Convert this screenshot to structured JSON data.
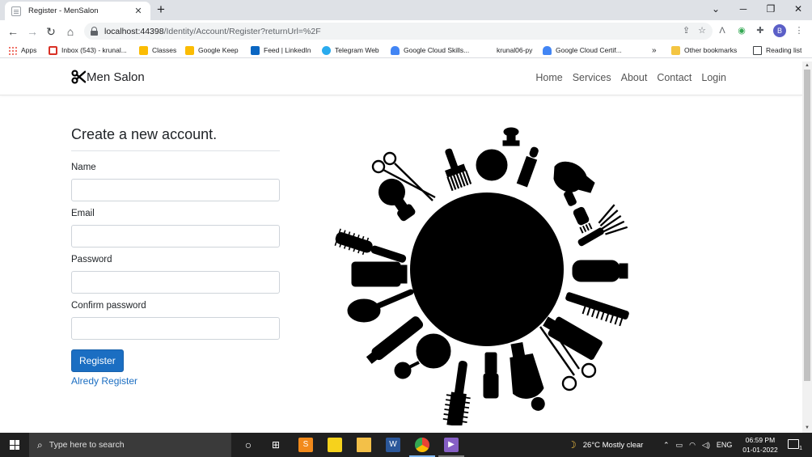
{
  "browser": {
    "tab_title": "Register - MenSalon",
    "tab_close": "✕",
    "new_tab": "+",
    "url_host": "localhost:44398",
    "url_path": "/Identity/Account/Register?returnUrl=%2F",
    "bookmarks": [
      {
        "label": "Apps",
        "color": "#ea4335"
      },
      {
        "label": "Inbox (543) - krunal...",
        "color": "#d93025"
      },
      {
        "label": "Classes",
        "color": "#fbbc04"
      },
      {
        "label": "Google Keep",
        "color": "#fbbc04"
      },
      {
        "label": "Feed | LinkedIn",
        "color": "#0a66c2"
      },
      {
        "label": "Telegram Web",
        "color": "#2aabee"
      },
      {
        "label": "Google Cloud Skills...",
        "color": "#4285f4"
      },
      {
        "label": "krunal06-py",
        "color": "#ffffff"
      },
      {
        "label": "Google Cloud Certif...",
        "color": "#4285f4"
      }
    ],
    "overflow": "»",
    "other_bookmarks": "Other bookmarks",
    "reading_list": "Reading list",
    "profile_initial": "B"
  },
  "site": {
    "brand": "Men Salon",
    "nav": [
      "Home",
      "Services",
      "About",
      "Contact",
      "Login"
    ]
  },
  "form": {
    "title": "Create a new account.",
    "fields": [
      {
        "label": "Name",
        "value": ""
      },
      {
        "label": "Email",
        "value": ""
      },
      {
        "label": "Password",
        "value": ""
      },
      {
        "label": "Confirm password",
        "value": ""
      }
    ],
    "submit_label": "Register",
    "alt_link": "Alredy Register"
  },
  "taskbar": {
    "search_placeholder": "Type here to search",
    "weather": "26°C  Mostly clear",
    "language": "ENG",
    "time": "06:59 PM",
    "date": "01-01-2022",
    "notification_count": "1"
  },
  "colors": {
    "accent": "#1b6ec2",
    "taskbar": "#202020",
    "tabstrip": "#dee1e6"
  }
}
